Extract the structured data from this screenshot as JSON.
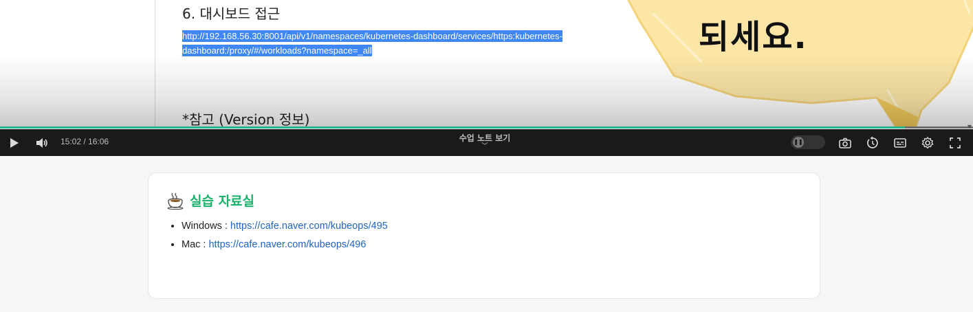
{
  "slide": {
    "heading": "6. 대시보드 접근",
    "url_text": "http://192.168.56.30:8001/api/v1/namespaces/kubernetes-dashboard/services/https:kubernetes-dashboard:/proxy/#/workloads?namespace=_all",
    "note": "*참고 (Version 정보)",
    "bubble_text": "되세요."
  },
  "player": {
    "time": "15:02 / 16:06",
    "progress": 0.93,
    "notes_toggle_label": "수업 노트 보기",
    "icons": [
      "play-icon",
      "volume-icon",
      "autoplay-toggle",
      "camera-icon",
      "replay-icon",
      "subtitles-icon",
      "settings-icon",
      "fullscreen-icon"
    ]
  },
  "resources": {
    "title": "실습 자료실",
    "items": [
      {
        "label": "Windows : ",
        "link": "https://cafe.naver.com/kubeops/495"
      },
      {
        "label": "Mac : ",
        "link": "https://cafe.naver.com/kubeops/496"
      }
    ]
  },
  "colors": {
    "accent_green": "#17b26a",
    "link_blue": "#1e63c5",
    "selection_blue": "#3f87f5",
    "player_bar": "#1a1a1a",
    "bubble_yellow": "#fbe6a6"
  }
}
